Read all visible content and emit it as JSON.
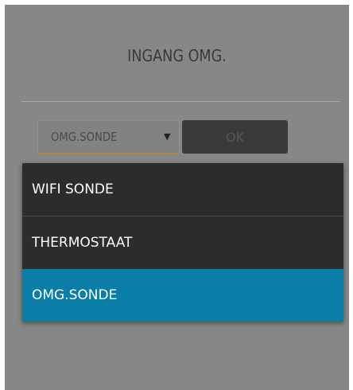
{
  "dialog": {
    "title": "INGANG OMG."
  },
  "select": {
    "value": "OMG.SONDE",
    "arrow_glyph": "▼",
    "arrow_icon": "dropdown-triangle-icon",
    "border_color": "#b48b45"
  },
  "ok_button": {
    "label": "OK"
  },
  "dropdown": {
    "options": [
      {
        "label": "WIFI SONDE",
        "selected": false
      },
      {
        "label": "THERMOSTAAT",
        "selected": false
      },
      {
        "label": "OMG.SONDE",
        "selected": true
      }
    ],
    "selected_color": "#0a7ea6",
    "background_color": "#2c2c2c"
  }
}
